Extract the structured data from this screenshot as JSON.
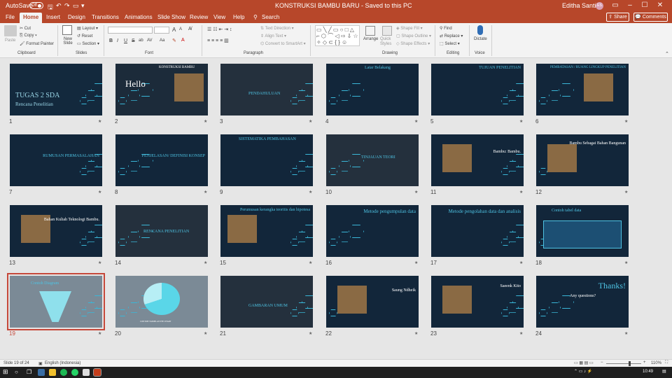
{
  "titlebar": {
    "autosave": "AutoSave",
    "autosave_state": "Off",
    "doc_title": "KONSTRUKSI BAMBU BARU  -  Saved to this PC",
    "user": "Editha Santika",
    "user_initials": "ES"
  },
  "tabs": [
    "File",
    "Home",
    "Insert",
    "Design",
    "Transitions",
    "Animations",
    "Slide Show",
    "Review",
    "View",
    "Help",
    "Search"
  ],
  "share": "Share",
  "comments": "Comments",
  "ribbon": {
    "clipboard": {
      "paste": "Paste",
      "cut": "Cut",
      "copy": "Copy",
      "format_painter": "Format Painter",
      "label": "Clipboard"
    },
    "slides": {
      "new_slide": "New Slide",
      "layout": "Layout",
      "reset": "Reset",
      "section": "Section",
      "label": "Slides"
    },
    "font": {
      "label": "Font",
      "bold": "B",
      "italic": "I",
      "underline": "U",
      "strike": "S",
      "shadow": "ab",
      "spacing": "AV",
      "case": "Aa",
      "grow": "A",
      "shrink": "A"
    },
    "paragraph": {
      "label": "Paragraph",
      "text_direction": "Text Direction",
      "align_text": "Align Text",
      "smartart": "Convert to SmartArt"
    },
    "drawing": {
      "label": "Drawing",
      "arrange": "Arrange",
      "quick_styles": "Quick Styles",
      "shape_fill": "Shape Fill",
      "shape_outline": "Shape Outline",
      "shape_effects": "Shape Effects"
    },
    "editing": {
      "label": "Editing",
      "find": "Find",
      "replace": "Replace",
      "select": "Select"
    },
    "voice": {
      "label": "Voice",
      "dictate": "Dictate"
    }
  },
  "slides": [
    {
      "n": "1",
      "title": "TUGAS 2 SDA",
      "sub": "Rencana Penelitian"
    },
    {
      "n": "2",
      "title": "Hello",
      "sub": "KONSTRUKSI BAMBU"
    },
    {
      "n": "3",
      "title": "PENDAHULUAN",
      "sub": ""
    },
    {
      "n": "4",
      "title": "Latar Belakang",
      "sub": ""
    },
    {
      "n": "5",
      "title": "TUJUAN PENELITIAN",
      "sub": ""
    },
    {
      "n": "6",
      "title": "PEMBATASAN / RUANG LINGKUP PENELITIAN",
      "sub": ""
    },
    {
      "n": "7",
      "title": "RUMUSAN PERMASALAHAN",
      "sub": ""
    },
    {
      "n": "8",
      "title": "PENJELASAN/ DEFINISI KONSEP",
      "sub": ""
    },
    {
      "n": "9",
      "title": "SISTEMATIKA PEMBAHASAN",
      "sub": ""
    },
    {
      "n": "10",
      "title": "TINJAUAN TEORI",
      "sub": ""
    },
    {
      "n": "11",
      "title": "Bambu: Bambu.",
      "sub": ""
    },
    {
      "n": "12",
      "title": "Bambu Sebagai Bahan Bangunan",
      "sub": ""
    },
    {
      "n": "13",
      "title": "Bahan Kuliah Teknologi Bambu.",
      "sub": ""
    },
    {
      "n": "14",
      "title": "RENCANA PENELITIAN",
      "sub": ""
    },
    {
      "n": "15",
      "title": "Perumusan kerangka teoritis dan hipotesa",
      "sub": ""
    },
    {
      "n": "16",
      "title": "Metode pengumpulan data",
      "sub": ""
    },
    {
      "n": "17",
      "title": "Metode pengolahan data dan analisis",
      "sub": ""
    },
    {
      "n": "18",
      "title": "Contoh tabel data",
      "sub": ""
    },
    {
      "n": "19",
      "title": "Contoh Diagram",
      "sub": ""
    },
    {
      "n": "20",
      "title": "",
      "sub": "CONTOH TAMPILAN PIE CHART"
    },
    {
      "n": "21",
      "title": "GAMBARAN UMUM",
      "sub": ""
    },
    {
      "n": "22",
      "title": "Saung Ndheik",
      "sub": ""
    },
    {
      "n": "23",
      "title": "Saeenk Kito",
      "sub": ""
    },
    {
      "n": "24",
      "title": "Thanks!",
      "sub": "Any questions?"
    }
  ],
  "status": {
    "slide": "Slide 19 of 24",
    "language": "English (Indonesia)",
    "zoom": "110%"
  },
  "clock": "10:49"
}
